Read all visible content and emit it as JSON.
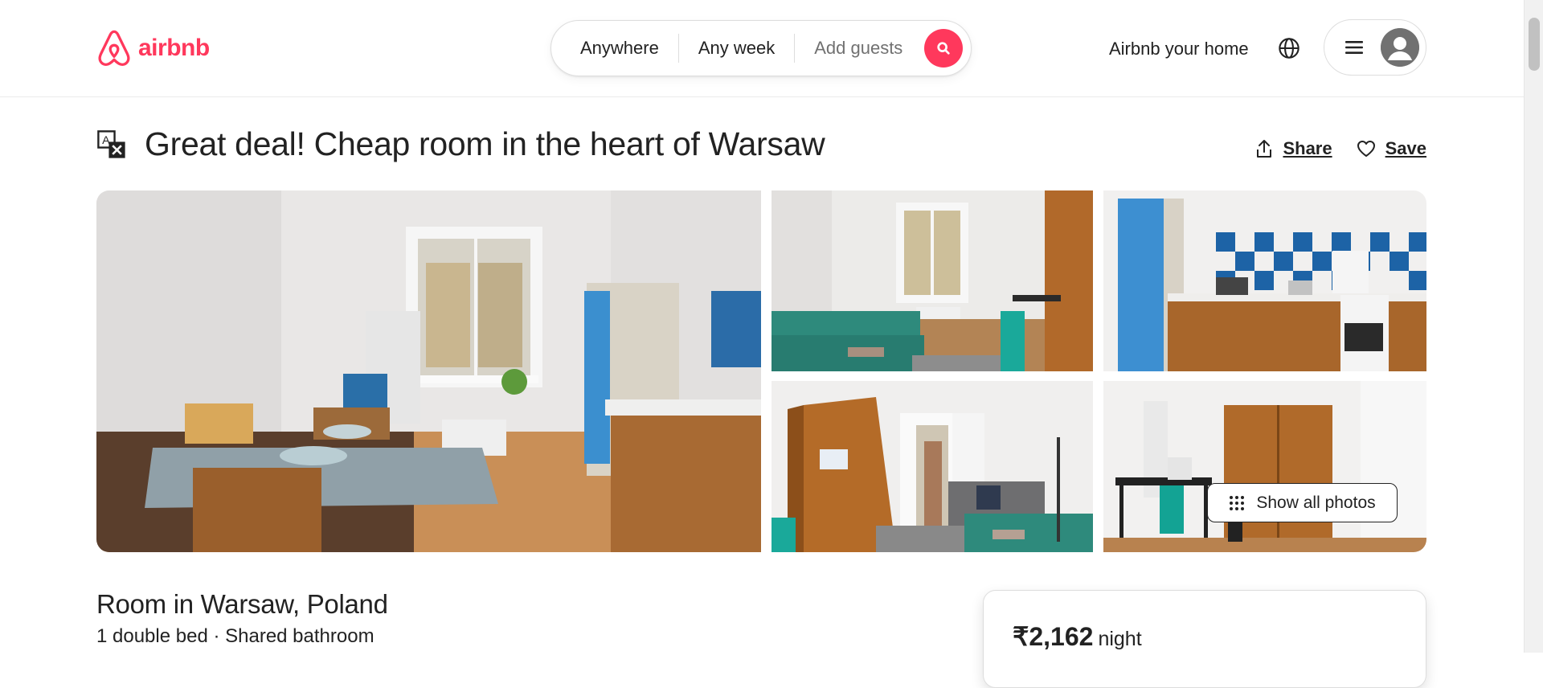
{
  "brand": {
    "name": "airbnb",
    "color": "#ff385c"
  },
  "search": {
    "location": "Anywhere",
    "dates": "Any week",
    "guests_placeholder": "Add guests"
  },
  "header": {
    "host_link": "Airbnb your home"
  },
  "listing": {
    "title": "Great deal! Cheap room in the heart of Warsaw",
    "share_label": "Share",
    "save_label": "Save",
    "show_all_photos": "Show all photos",
    "room_title": "Room in Warsaw, Poland",
    "room_summary": "1 double bed · Shared bathroom",
    "price": "₹2,162",
    "price_unit": "night"
  },
  "icons": {
    "translate": "translate-icon",
    "search": "search-icon",
    "globe": "globe-icon",
    "menu": "hamburger-menu-icon",
    "avatar": "user-avatar-icon",
    "share": "share-upload-icon",
    "save": "heart-icon",
    "grid": "grid-dots-icon"
  }
}
